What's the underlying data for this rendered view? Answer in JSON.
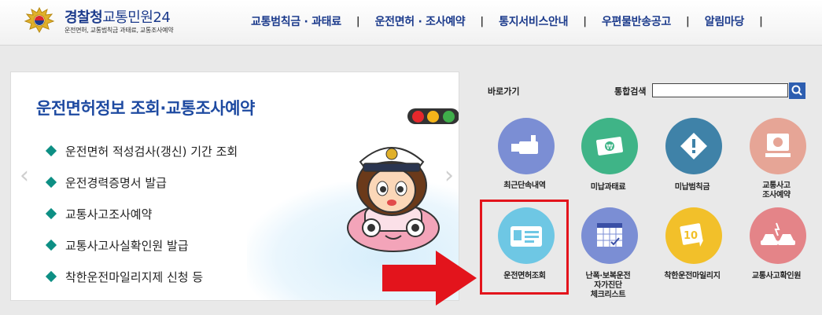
{
  "header": {
    "logo_title_main": "경찰청",
    "logo_title_sub": "교통민원24",
    "logo_subtitle": "운전면허, 교통범칙금 과태료, 교통조사예약",
    "nav": [
      "교통범칙금 · 과태료",
      "운전면허 · 조사예약",
      "통지서비스안내",
      "우편물반송공고",
      "알림마당"
    ],
    "separator": "|"
  },
  "banner": {
    "title": "운전면허정보 조회·교통조사예약",
    "items": [
      "운전면허 적성검사(갱신) 기간 조회",
      "운전경력증명서 발급",
      "교통사고조사예약",
      "교통사고사실확인원 발급",
      "착한운전마일리지제 신청 등"
    ],
    "prev": "‹",
    "next": "›"
  },
  "quick": {
    "label": "바로가기",
    "search_label": "통합검색",
    "search_value": "",
    "items": [
      {
        "label": "최근단속내역",
        "color": "#7b8ed4",
        "icon": "camera-icon"
      },
      {
        "label": "미납과태료",
        "color": "#3fb487",
        "icon": "money-icon"
      },
      {
        "label": "미납범칙금",
        "color": "#3f82a8",
        "icon": "warning-icon"
      },
      {
        "label": "교통사고\n조사예약",
        "color": "#e6a596",
        "icon": "computer-icon"
      },
      {
        "label": "운전면허조회",
        "color": "#6ec7e4",
        "icon": "license-card-icon"
      },
      {
        "label": "난폭·보복운전\n자가진단\n체크리스트",
        "color": "#7b8ed4",
        "icon": "checklist-icon"
      },
      {
        "label": "착한운전마일리지",
        "color": "#f2c02a",
        "icon": "mileage-icon"
      },
      {
        "label": "교통사고확인원",
        "color": "#e48488",
        "icon": "car-crash-icon"
      }
    ]
  },
  "colors": {
    "brand": "#1c3b8c",
    "banner_title": "#1e4aa1",
    "bullet": "#0d8f84",
    "highlight": "#e3141c",
    "search_button": "#2d5eb0"
  }
}
